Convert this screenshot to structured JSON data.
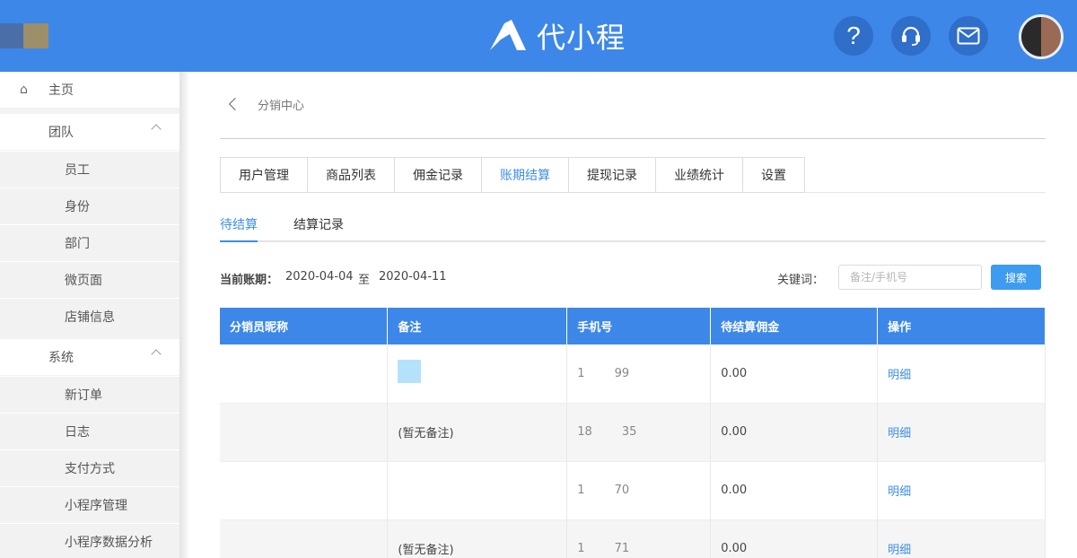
{
  "header": {
    "brand": "代小程",
    "help_glyph": "?",
    "icons": [
      "help-icon",
      "headset-icon",
      "mail-icon",
      "avatar"
    ]
  },
  "sidebar": {
    "home": "主页",
    "groups": [
      {
        "label": "团队",
        "items": [
          "员工",
          "身份",
          "部门",
          "微页面",
          "店铺信息"
        ]
      },
      {
        "label": "系统",
        "items": [
          "新订单",
          "日志",
          "支付方式",
          "小程序管理",
          "小程序数据分析"
        ]
      }
    ]
  },
  "breadcrumb": {
    "title": "分销中心"
  },
  "tabs": [
    "用户管理",
    "商品列表",
    "佣金记录",
    "账期结算",
    "提现记录",
    "业绩统计",
    "设置"
  ],
  "active_tab": "账期结算",
  "subtabs": [
    "待结算",
    "结算记录"
  ],
  "active_subtab": "待结算",
  "filter": {
    "period_label": "当前账期：",
    "start": "2020-04-04",
    "to": "至",
    "end": "2020-04-11",
    "keyword_label": "关键词：",
    "keyword_placeholder": "备注/手机号",
    "search_label": "搜索"
  },
  "table": {
    "columns": [
      "分销员昵称",
      "备注",
      "手机号",
      "待结算佣金",
      "操作"
    ],
    "rows": [
      {
        "nickname": "",
        "remark": "",
        "phone": "1        99",
        "commission": "0.00",
        "action": "明细"
      },
      {
        "nickname": "",
        "remark": "(暂无备注)",
        "phone": "18        35",
        "commission": "0.00",
        "action": "明细"
      },
      {
        "nickname": "",
        "remark": "",
        "phone": "1        70",
        "commission": "0.00",
        "action": "明细"
      },
      {
        "nickname": "",
        "remark": "(暂无备注)",
        "phone": "1        71",
        "commission": "0.00",
        "action": "明细"
      }
    ]
  },
  "colors": {
    "primary": "#3d87e8",
    "accent": "#3d8ee8",
    "sidebar_bg": "#f2f2f2"
  }
}
